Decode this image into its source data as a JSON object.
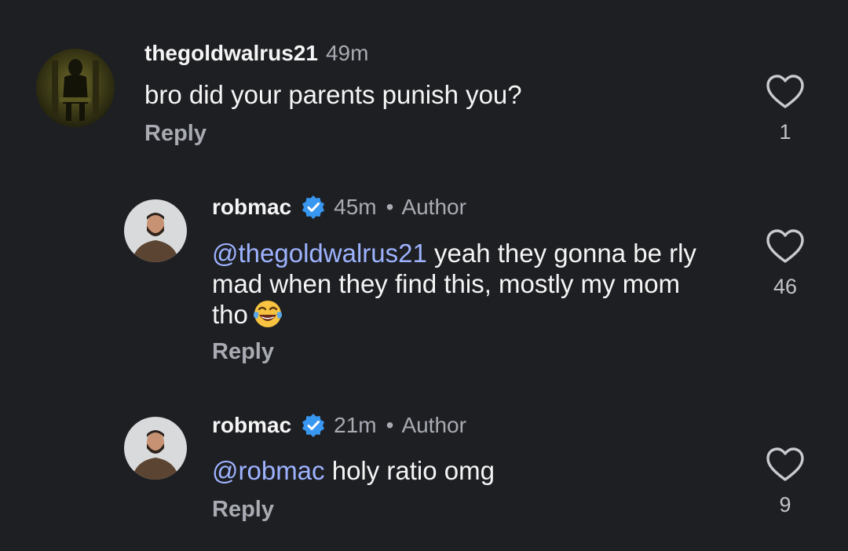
{
  "comments": [
    {
      "username": "thegoldwalrus21",
      "time": "49m",
      "text": "bro did your parents punish you?",
      "reply_label": "Reply",
      "likes": "1",
      "avatar_icon": "dark-figure-avatar",
      "like_icon": "heart-outline-icon"
    },
    {
      "username": "robmac",
      "verified_icon": "verified-badge-icon",
      "time": "45m",
      "separator": "•",
      "author_label": "Author",
      "mention": "@thegoldwalrus21",
      "text": "yeah they gonna be rly mad when they find this, mostly my mom tho",
      "emoji": "face-with-tears-of-joy",
      "reply_label": "Reply",
      "likes": "46",
      "avatar_icon": "bearded-man-avatar",
      "like_icon": "heart-outline-icon"
    },
    {
      "username": "robmac",
      "verified_icon": "verified-badge-icon",
      "time": "21m",
      "separator": "•",
      "author_label": "Author",
      "mention": "@robmac",
      "text": "holy ratio omg",
      "reply_label": "Reply",
      "likes": "9",
      "avatar_icon": "bearded-man-avatar",
      "like_icon": "heart-outline-icon"
    }
  ],
  "colors": {
    "background": "#1e1f23",
    "primary_text": "#f5f5f5",
    "secondary_text": "#a8abb2",
    "mention": "#9db3ff",
    "verified": "#3897f0"
  }
}
